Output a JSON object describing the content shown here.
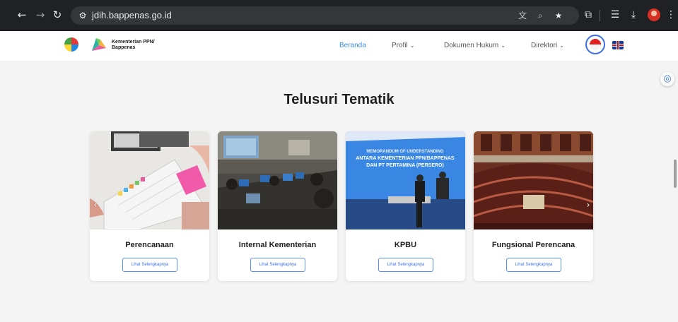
{
  "browser": {
    "url": "jdih.bappenas.go.id",
    "icons": {
      "back": "arrow-left-icon",
      "forward": "arrow-right-icon",
      "reload": "reload-icon",
      "site_info": "tune-icon",
      "translate": "translate-icon",
      "zoom": "zoom-icon",
      "bookmark": "star-icon",
      "extensions": "puzzle-icon",
      "reading_list": "reading-list-icon",
      "downloads": "download-icon",
      "menu": "more-vertical-icon"
    }
  },
  "site": {
    "logo_text_line1": "Kementerian PPN/",
    "logo_text_line2": "Bappenas",
    "menu": [
      {
        "label": "Beranda",
        "active": true,
        "dropdown": false
      },
      {
        "label": "Profil",
        "active": false,
        "dropdown": true
      },
      {
        "label": "Dokumen Hukum",
        "active": false,
        "dropdown": true
      },
      {
        "label": "Direktori",
        "active": false,
        "dropdown": true
      }
    ],
    "languages": [
      "indonesia-flag-icon",
      "uk-flag-icon"
    ]
  },
  "section": {
    "title": "Telusuri Tematik",
    "cards": [
      {
        "title": "Perencanaan",
        "button": "Lihat Selengkapnya"
      },
      {
        "title": "Internal Kementerian",
        "button": "Lihat Selengkapnya"
      },
      {
        "title": "KPBU",
        "button": "Lihat Selengkapnya",
        "image_text_1": "MEMORANDUM OF UNDERSTANDING",
        "image_text_2": "ANTARA KEMENTERIAN PPN/BAPPENAS",
        "image_text_3": "DAN PT PERTAMINA (PERSERO)"
      },
      {
        "title": "Fungsional Perencana",
        "button": "Lihat Selengkapnya"
      }
    ]
  },
  "colors": {
    "accent": "#3a8ee6",
    "page_bg": "#f4f4f4",
    "chrome_bg": "#202124"
  }
}
